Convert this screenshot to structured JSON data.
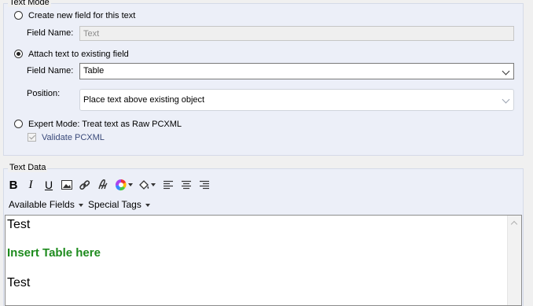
{
  "text_mode": {
    "legend": "Text Mode",
    "option_create": "Create new field for this text",
    "field_name_label_1": "Field Name:",
    "field_name_value_1": "Text",
    "option_attach": "Attach text to existing field",
    "field_name_label_2": "Field Name:",
    "field_name_value_2": "Table",
    "position_label": "Position:",
    "position_value": "Place text above existing object",
    "option_expert": "Expert Mode: Treat text as Raw PCXML",
    "validate_label": "Validate PCXML",
    "selected_option": "attach"
  },
  "text_data": {
    "legend": "Text Data",
    "toolbar_icons": [
      "bold-icon",
      "italic-icon",
      "underline-icon",
      "image-icon",
      "link-icon",
      "font-icon",
      "color-picker-icon",
      "highlight-icon",
      "align-left-icon",
      "align-center-icon",
      "align-right-icon"
    ],
    "menu_available_fields": "Available Fields",
    "menu_special_tags": "Special Tags",
    "editor_lines": [
      "Test",
      "Insert Table here",
      "Test"
    ],
    "highlight_color": "#1e8b1e"
  }
}
